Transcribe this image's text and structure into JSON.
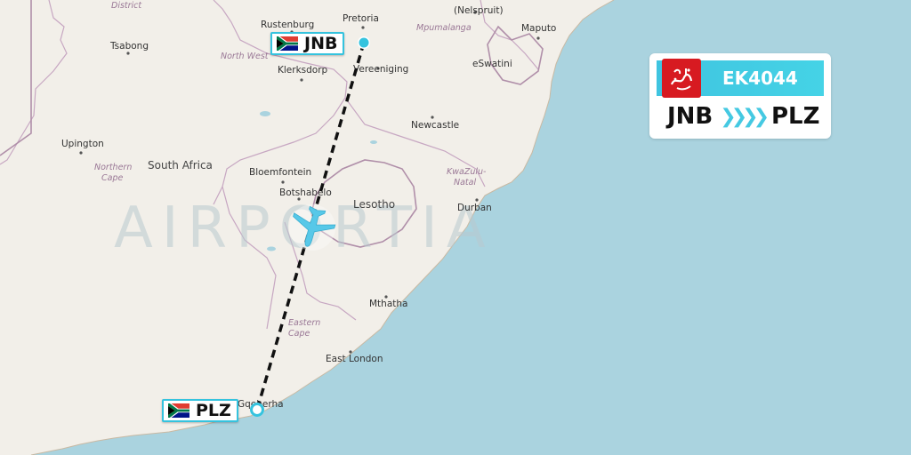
{
  "brand": {
    "watermark": "AIRPORTIA"
  },
  "flight": {
    "number": "EK4044",
    "origin": "JNB",
    "destination": "PLZ",
    "route_arrow": "❯❯❯❯",
    "airline_logo": "emirates-logo"
  },
  "map": {
    "places": {
      "rustenburg": "Rustenburg",
      "pretoria": "Pretoria",
      "nelspruit": "(Nelspruit)",
      "maputo": "Maputo",
      "tsabong": "Tsabong",
      "klerksdorp": "Klerksdorp",
      "vereeniging": "Vereeniging",
      "upington": "Upington",
      "south_africa": "South Africa",
      "bloemfontein": "Bloemfontein",
      "botshabelo": "Botshabelo",
      "lesotho": "Lesotho",
      "newcastle": "Newcastle",
      "durban": "Durban",
      "mthatha": "Mthatha",
      "east_london": "East London",
      "gqeberha": "Gqeberha",
      "eswatini": "eSwatini"
    },
    "regions": {
      "district": "District",
      "north_west": "North West",
      "mpumalanga": "Mpumalanga",
      "northern": "Northern",
      "cape": "Cape",
      "kwazulu": "KwaZulu-",
      "natal": "Natal",
      "eastern": "Eastern",
      "eastern_cape": "Cape"
    },
    "colors": {
      "land": "#f2efe9",
      "water": "#aad3df",
      "route": "#111111",
      "accent": "#35c3de",
      "airline_red": "#d71a21"
    }
  }
}
